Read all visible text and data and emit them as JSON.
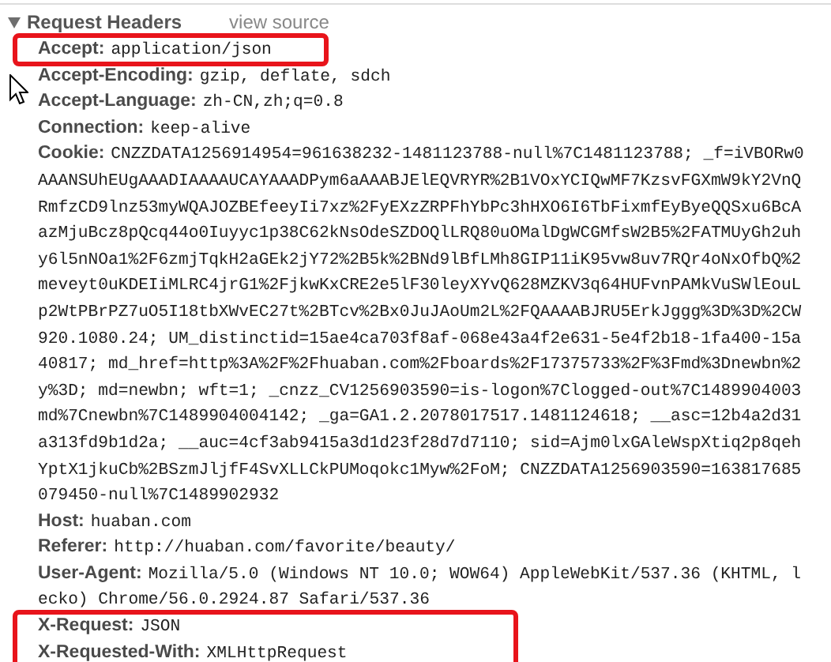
{
  "section": {
    "title": "Request Headers",
    "expanded": true,
    "link": "view source"
  },
  "headers": [
    {
      "name": "Accept:",
      "value": [
        "application/json"
      ],
      "highlighted": true
    },
    {
      "name": "Accept-Encoding:",
      "value": [
        "gzip, deflate, sdch"
      ],
      "highlighted": false
    },
    {
      "name": "Accept-Language:",
      "value": [
        "zh-CN,zh;q=0.8"
      ],
      "highlighted": false
    },
    {
      "name": "Connection:",
      "value": [
        "keep-alive"
      ],
      "highlighted": false
    },
    {
      "name": "Cookie:",
      "value": [
        "CNZZDATA1256914954=961638232-1481123788-null%7C1481123788; _f=iVBORw0",
        "AAANSUhEUgAAADIAAAAUCAYAAADPym6aAAABJElEQVRYR%2B1VOxYCIQwMF7KzsvFGXmW9kY2VnQ",
        "RmfzCD9lnz53myWQAJOZBEfeeyIi7xz%2FyEXzZRPFhYbPc3hHXO6I6TbFixmfEyByeQQSxu6BcA",
        "azMjuBcz8pQcq44o0Iuyyc1p38C62kNsOdeSZDOQlLRQ80uOMalDgWCGMfsW2B5%2FATMUyGh2uh",
        "y6l5nNOa1%2F6zmjTqkH2aGEk2jY72%2B5k%2BNd9lBfLMh8GIP11iK95vw8uv7RQr4oNxOfbQ%2",
        "meveyt0uKDEIiMLRC4jrG1%2FjkwKxCRE2e5lF30leyXYvQ628MZKV3q64HUFvnPAMkVuSWlEouL",
        "p2WtPBrPZ7uO5I18tbXWvEC27t%2BTcv%2Bx0JuJAoUm2L%2FQAAAABJRU5ErkJggg%3D%3D%2CW",
        "920.1080.24; UM_distinctid=15ae4ca703f8af-068e43a4f2e631-5e4f2b18-1fa400-15a",
        "40817; md_href=http%3A%2F%2Fhuaban.com%2Fboards%2F17375733%2F%3Fmd%3Dnewbn%2",
        "y%3D; md=newbn; wft=1; _cnzz_CV1256903590=is-logon%7Clogged-out%7C1489904003",
        "md%7Cnewbn%7C1489904004142; _ga=GA1.2.2078017517.1481124618; __asc=12b4a2d31",
        "a313fd9b1d2a; __auc=4cf3ab9415a3d1d23f28d7d7110; sid=Ajm0lxGAleWspXtiq2p8qeh",
        "YptX1jkuCb%2BSzmJljfF4SvXLLCkPUMoqokc1Myw%2FoM; CNZZDATA1256903590=163817685",
        "079450-null%7C1489902932"
      ],
      "highlighted": false
    },
    {
      "name": "Host:",
      "value": [
        "huaban.com"
      ],
      "highlighted": false
    },
    {
      "name": "Referer:",
      "value": [
        "http://huaban.com/favorite/beauty/"
      ],
      "highlighted": false
    },
    {
      "name": "User-Agent:",
      "value": [
        "Mozilla/5.0 (Windows NT 10.0; WOW64) AppleWebKit/537.36 (KHTML, l",
        "ecko) Chrome/56.0.2924.87 Safari/537.36"
      ],
      "highlighted": false
    },
    {
      "name": "X-Request:",
      "value": [
        "JSON"
      ],
      "highlighted": true
    },
    {
      "name": "X-Requested-With:",
      "value": [
        "XMLHttpRequest"
      ],
      "highlighted": true
    }
  ]
}
